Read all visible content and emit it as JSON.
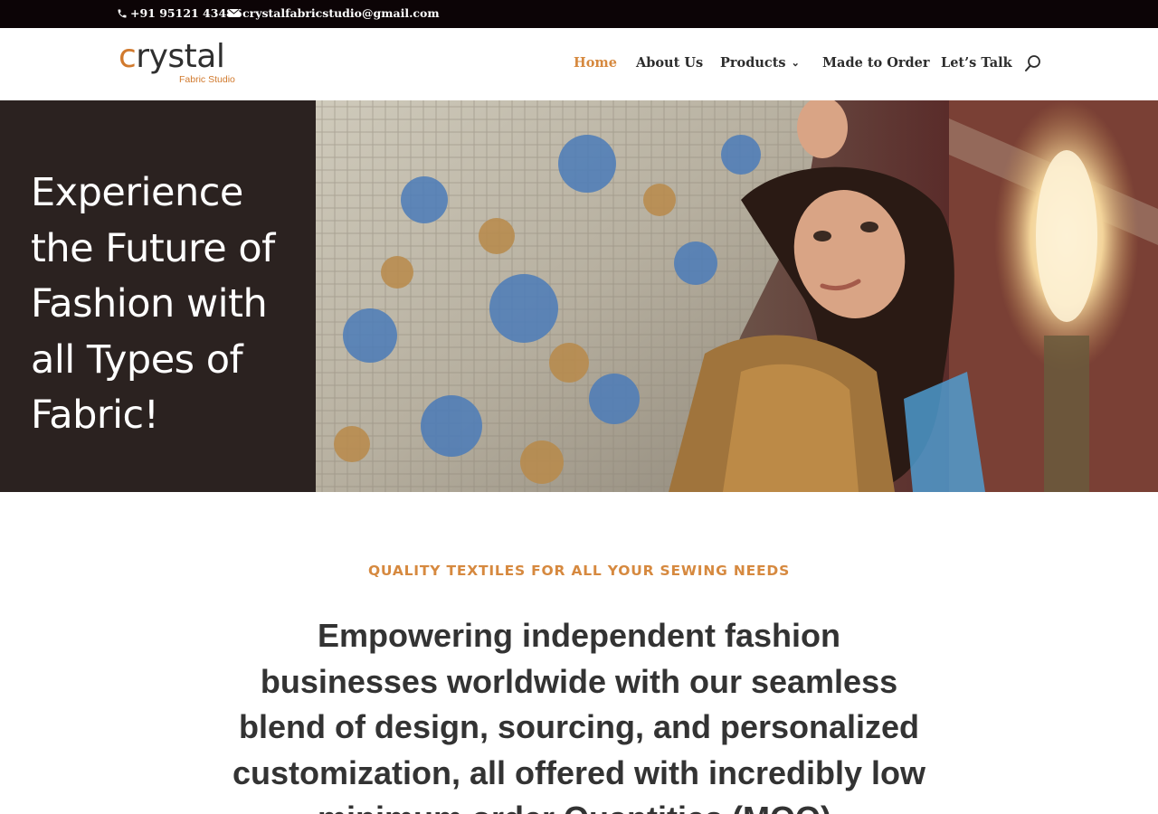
{
  "topbar": {
    "phone": "+91 95121 43486",
    "email": "crystalfabricstudio@gmail.com",
    "phone_icon": "phone-icon",
    "email_icon": "envelope-icon"
  },
  "brand": {
    "name_first": "c",
    "name_rest": "rystal",
    "tagline": "Fabric Studio"
  },
  "nav": {
    "items": [
      {
        "label": "Home",
        "active": true
      },
      {
        "label": "About Us"
      },
      {
        "label": "Products",
        "dropdown_icon": "chevron-down-icon"
      },
      {
        "label": "Made to Order"
      },
      {
        "label": "Let’s Talk"
      }
    ],
    "search_icon": "search-icon"
  },
  "hero": {
    "heading": "Experience the Future of Fashion with all Types of Fabric!"
  },
  "intro": {
    "eyebrow": "QUALITY TEXTILES FOR ALL YOUR SEWING NEEDS",
    "headline": "Empowering independent fashion businesses worldwide with our seamless blend of design, sourcing, and personalized customization, all offered with incredibly low minimum order Quantities (MOQ)."
  },
  "colors": {
    "accent": "#d6893f",
    "topbar_bg": "#0c0406",
    "hero_panel": "#2b2220",
    "text_dark": "#333333"
  }
}
